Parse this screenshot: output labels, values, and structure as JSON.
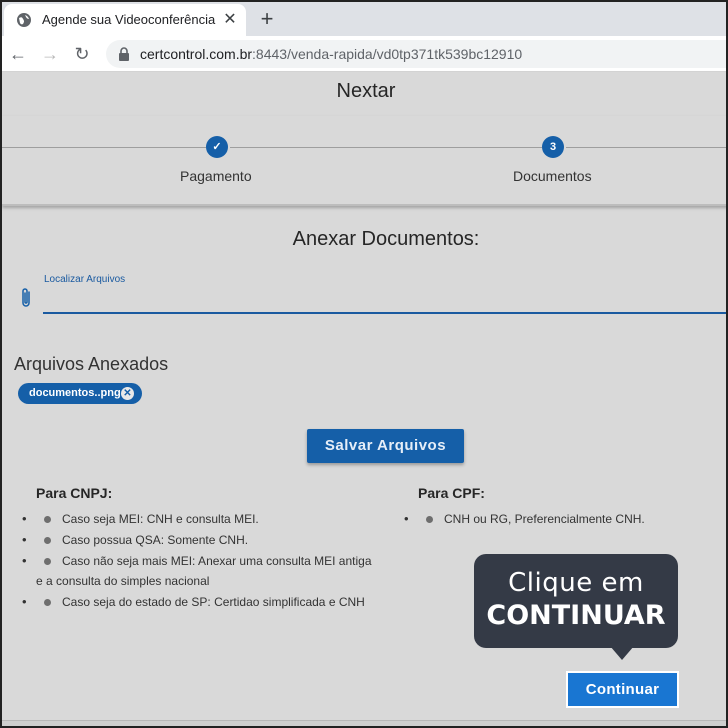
{
  "browser": {
    "tab_title": "Agende sua Videoconferência",
    "url_host": "certcontrol.com.br",
    "url_path": ":8443/venda-rapida/vd0tp371tk539bc12910",
    "icons": [
      "globe-icon",
      "close-icon",
      "plus-icon",
      "back-arrow-icon",
      "forward-arrow-icon",
      "reload-icon",
      "lock-icon"
    ]
  },
  "app": {
    "title": "Nextar"
  },
  "stepper": {
    "steps": [
      {
        "label": "Pagamento",
        "marker": "✓",
        "done": true
      },
      {
        "label": "Documentos",
        "marker": "3",
        "done": false
      }
    ]
  },
  "documents": {
    "title": "Anexar Documentos:",
    "file_field_label": "Localizar Arquivos",
    "attached_title": "Arquivos Anexados",
    "chip_label": "documentos..png",
    "save_button": "Salvar Arquivos"
  },
  "requirements": {
    "cnpj_title": "Para CNPJ:",
    "cnpj_items": [
      "Caso seja MEI: CNH e consulta MEI.",
      "Caso possua QSA: Somente CNH.",
      "Caso não seja mais MEI: Anexar uma consulta MEI antiga",
      "e a consulta do simples nacional",
      "Caso seja do estado de SP: Certidao simplificada e CNH"
    ],
    "cpf_title": "Para CPF:",
    "cpf_items": [
      "CNH ou RG, Preferencialmente CNH."
    ]
  },
  "callout": {
    "line1": "Clique em",
    "line2": "CONTINUAR"
  },
  "footer": {
    "continue_button": "Continuar"
  },
  "colors": {
    "primary": "#155fa8",
    "callout_bg": "#343a46",
    "page_bg": "#d9d9d9"
  }
}
